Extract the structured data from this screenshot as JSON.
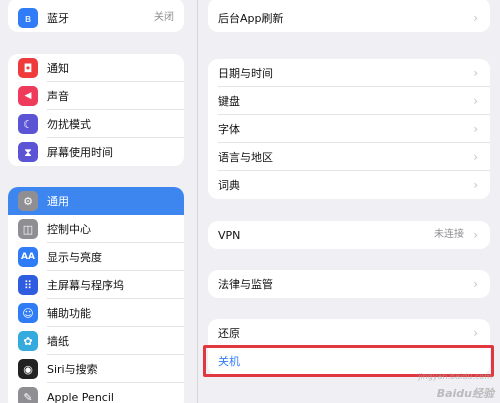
{
  "sidebar": {
    "group1": [
      {
        "label": "蓝牙",
        "value": "关闭",
        "icon": "bluetooth-icon",
        "color": "#2f7cf6",
        "glyph": "ʙ"
      }
    ],
    "group2": [
      {
        "label": "通知",
        "icon": "notifications-icon",
        "color": "#ef3b3b",
        "glyph": "◘"
      },
      {
        "label": "声音",
        "icon": "sound-icon",
        "color": "#ef3b5b",
        "glyph": "◀"
      },
      {
        "label": "勿扰模式",
        "icon": "moon-icon",
        "color": "#5b55d6",
        "glyph": "☾"
      },
      {
        "label": "屏幕使用时间",
        "icon": "hourglass-icon",
        "color": "#5b55d6",
        "glyph": "⧗"
      }
    ],
    "group3": [
      {
        "label": "通用",
        "icon": "gear-icon",
        "color": "#8e8e93",
        "glyph": "⚙",
        "selected": true
      },
      {
        "label": "控制中心",
        "icon": "control-center-icon",
        "color": "#8e8e93",
        "glyph": "◫"
      },
      {
        "label": "显示与亮度",
        "icon": "display-icon",
        "color": "#2f7cf6",
        "glyph": "AA"
      },
      {
        "label": "主屏幕与程序坞",
        "icon": "home-screen-icon",
        "color": "#2f5de0",
        "glyph": "⠿"
      },
      {
        "label": "辅助功能",
        "icon": "accessibility-icon",
        "color": "#2f7cf6",
        "glyph": "☺"
      },
      {
        "label": "墙纸",
        "icon": "wallpaper-icon",
        "color": "#35aadc",
        "glyph": "✿"
      },
      {
        "label": "Siri与搜索",
        "icon": "siri-icon",
        "color": "#222222",
        "glyph": "◉"
      },
      {
        "label": "Apple Pencil",
        "icon": "pencil-icon",
        "color": "#8e8e93",
        "glyph": "✎"
      }
    ]
  },
  "detail": {
    "top": [
      "后台App刷新"
    ],
    "group_datetime": [
      "日期与时间",
      "键盘",
      "字体",
      "语言与地区",
      "词典"
    ],
    "group_vpn": {
      "label": "VPN",
      "value": "未连接"
    },
    "group_legal": [
      "法律与监管"
    ],
    "group_reset": {
      "reset": "还原",
      "shutdown": "关机"
    }
  },
  "watermark": {
    "main": "Baidu经验",
    "sub": "jingyan.baidu.com"
  },
  "colors": {
    "accent": "#3d86f0",
    "highlight": "#e0383e",
    "link": "#2f7cf6"
  }
}
